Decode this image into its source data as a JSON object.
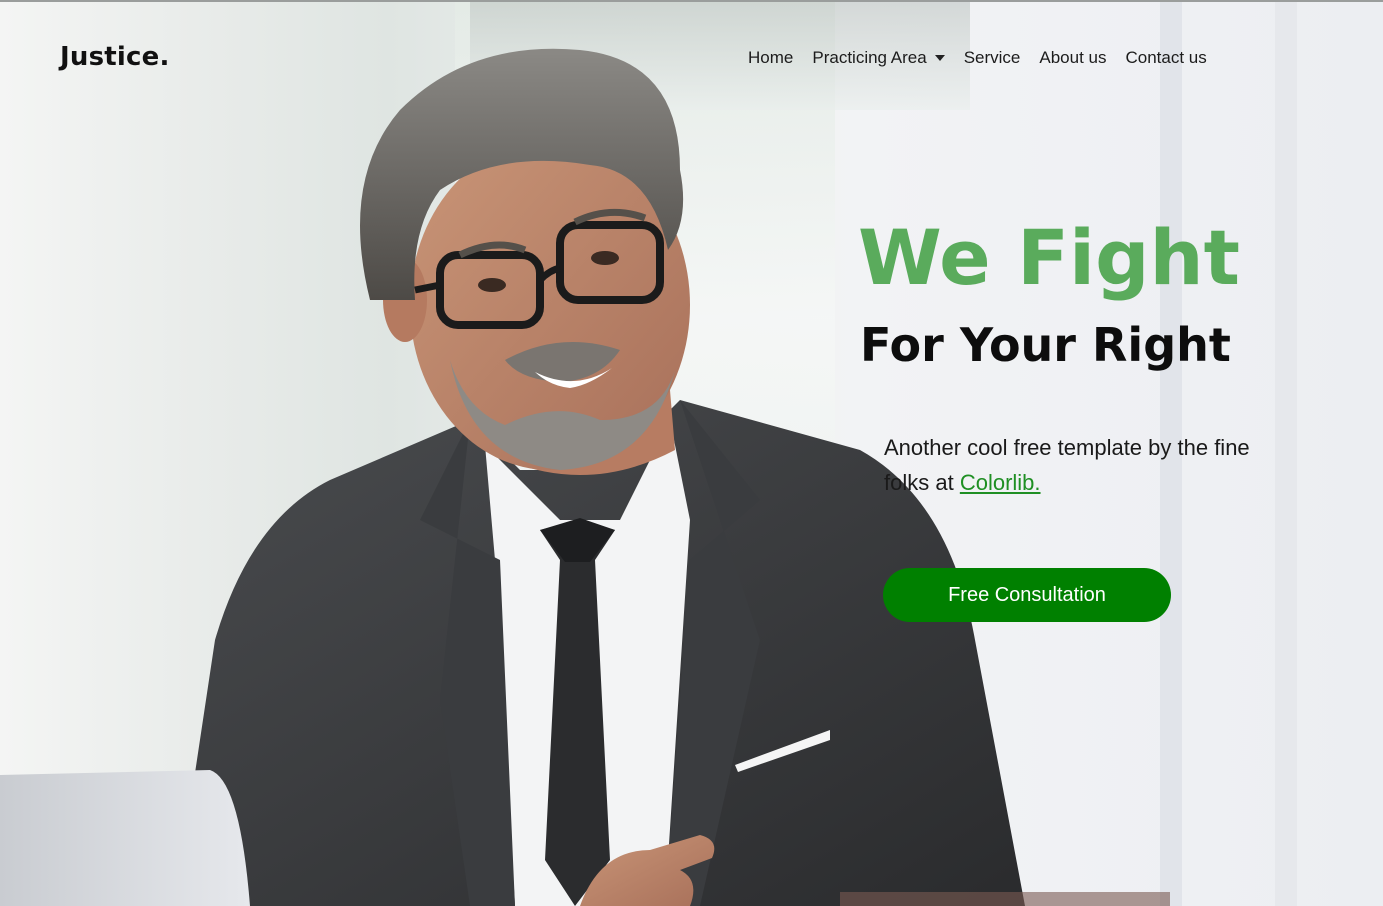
{
  "brand": {
    "name": "Justice."
  },
  "nav": {
    "items": [
      {
        "label": "Home",
        "dropdown": false
      },
      {
        "label": "Practicing Area",
        "dropdown": true
      },
      {
        "label": "Service",
        "dropdown": false
      },
      {
        "label": "About us",
        "dropdown": false
      },
      {
        "label": "Contact us",
        "dropdown": false
      }
    ]
  },
  "hero": {
    "headline_primary": "We Fight",
    "headline_secondary": "For Your Right",
    "description_text": "Another cool free template by the fine folks at",
    "description_link": "Colorlib.",
    "cta_label": "Free Consultation"
  },
  "colors": {
    "accent_green": "#5aab5c",
    "button_green": "#008000",
    "link_green": "#1f8f23",
    "text_dark": "#0d0d0d"
  },
  "icons": {
    "dropdown": "caret-down-icon"
  }
}
